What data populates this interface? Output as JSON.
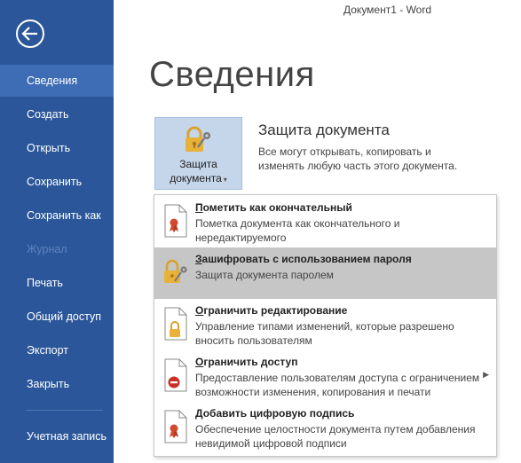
{
  "window": {
    "title": "Документ1 - Word"
  },
  "sidebar": {
    "back_label": "Назад",
    "items": [
      {
        "label": "Сведения"
      },
      {
        "label": "Создать"
      },
      {
        "label": "Открыть"
      },
      {
        "label": "Сохранить"
      },
      {
        "label": "Сохранить как"
      },
      {
        "label": "Журнал"
      },
      {
        "label": "Печать"
      },
      {
        "label": "Общий доступ"
      },
      {
        "label": "Экспорт"
      },
      {
        "label": "Закрыть"
      }
    ],
    "account_label": "Учетная запись",
    "selected": "Сведения",
    "disabled": "Журнал"
  },
  "main": {
    "title": "Сведения",
    "protect_button": {
      "label_line1": "Защита",
      "label_line2": "документа",
      "icon": "lock-key-icon"
    },
    "section": {
      "heading": "Защита документа",
      "description": "Все могут открывать, копировать и изменять любую часть этого документа."
    }
  },
  "menu": {
    "items": [
      {
        "title_u": "П",
        "title_rest": "ометить как окончательный",
        "description": "Пометка документа как окончательного и нередактируемого",
        "icon": "mark-final-icon"
      },
      {
        "title_u": "З",
        "title_rest": "ашифровать с использованием пароля",
        "description": "Защита документа паролем",
        "icon": "encrypt-lock-icon"
      },
      {
        "title_u": "О",
        "title_rest": "граничить редактирование",
        "description": "Управление типами изменений, которые разрешено вносить пользователям",
        "icon": "restrict-editing-icon"
      },
      {
        "title_u": "О",
        "title_rest": "граничить доступ",
        "description": "Предоставление пользователям доступа с ограничением возможности изменения, копирования и печати",
        "icon": "restrict-access-icon"
      },
      {
        "title_u": "Д",
        "title_rest": "обавить цифровую подпись",
        "description": "Обеспечение целостности документа путем добавления невидимой цифровой подписи",
        "icon": "digital-signature-icon"
      }
    ]
  },
  "colors": {
    "sidebar": "#2b579a",
    "sidebar_selected": "#3e6db5",
    "button_bg": "#c5d5ea",
    "menu_hover": "#c6c6c6",
    "lock_gold": "#e8b23a"
  }
}
